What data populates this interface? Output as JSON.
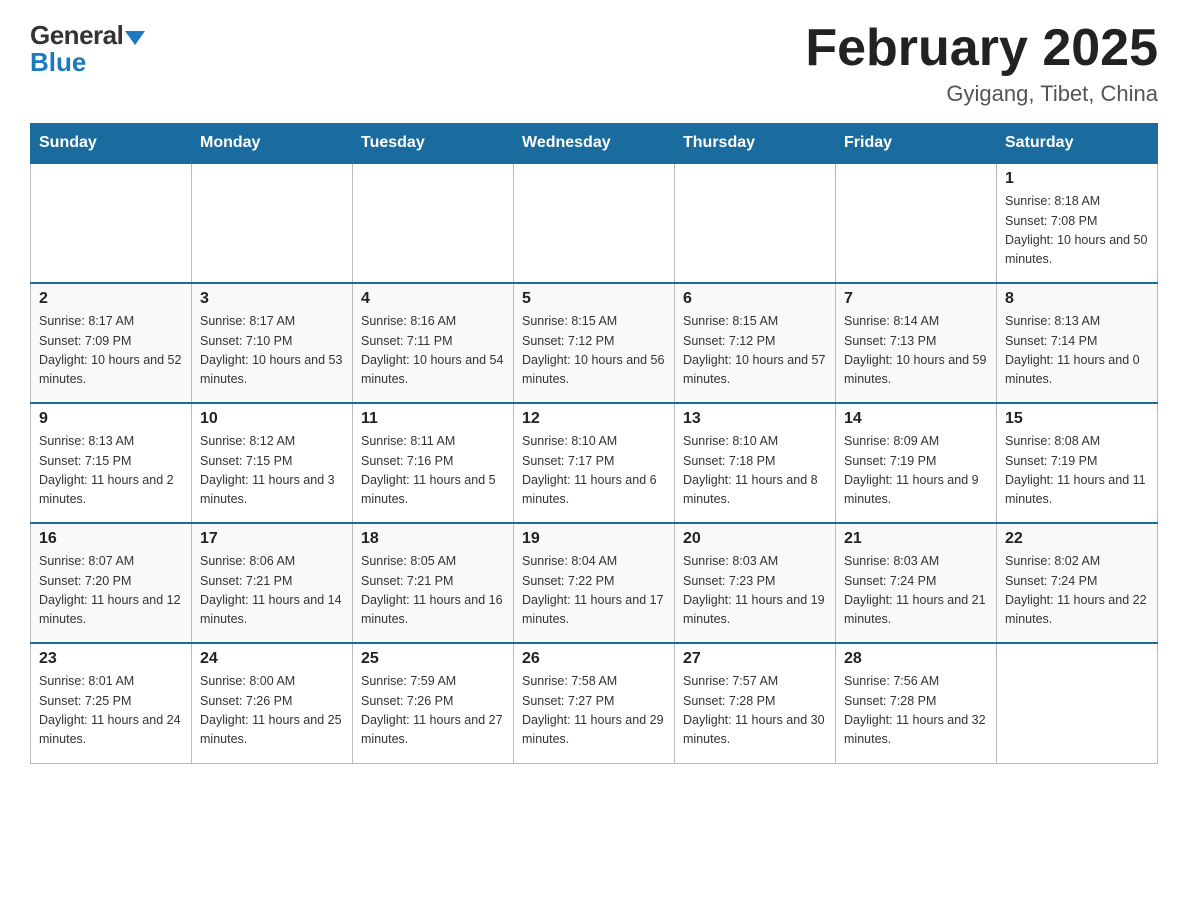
{
  "header": {
    "logo_general": "General",
    "logo_blue": "Blue",
    "title": "February 2025",
    "location": "Gyigang, Tibet, China"
  },
  "days_of_week": [
    "Sunday",
    "Monday",
    "Tuesday",
    "Wednesday",
    "Thursday",
    "Friday",
    "Saturday"
  ],
  "weeks": [
    [
      {
        "day": "",
        "sunrise": "",
        "sunset": "",
        "daylight": ""
      },
      {
        "day": "",
        "sunrise": "",
        "sunset": "",
        "daylight": ""
      },
      {
        "day": "",
        "sunrise": "",
        "sunset": "",
        "daylight": ""
      },
      {
        "day": "",
        "sunrise": "",
        "sunset": "",
        "daylight": ""
      },
      {
        "day": "",
        "sunrise": "",
        "sunset": "",
        "daylight": ""
      },
      {
        "day": "",
        "sunrise": "",
        "sunset": "",
        "daylight": ""
      },
      {
        "day": "1",
        "sunrise": "Sunrise: 8:18 AM",
        "sunset": "Sunset: 7:08 PM",
        "daylight": "Daylight: 10 hours and 50 minutes."
      }
    ],
    [
      {
        "day": "2",
        "sunrise": "Sunrise: 8:17 AM",
        "sunset": "Sunset: 7:09 PM",
        "daylight": "Daylight: 10 hours and 52 minutes."
      },
      {
        "day": "3",
        "sunrise": "Sunrise: 8:17 AM",
        "sunset": "Sunset: 7:10 PM",
        "daylight": "Daylight: 10 hours and 53 minutes."
      },
      {
        "day": "4",
        "sunrise": "Sunrise: 8:16 AM",
        "sunset": "Sunset: 7:11 PM",
        "daylight": "Daylight: 10 hours and 54 minutes."
      },
      {
        "day": "5",
        "sunrise": "Sunrise: 8:15 AM",
        "sunset": "Sunset: 7:12 PM",
        "daylight": "Daylight: 10 hours and 56 minutes."
      },
      {
        "day": "6",
        "sunrise": "Sunrise: 8:15 AM",
        "sunset": "Sunset: 7:12 PM",
        "daylight": "Daylight: 10 hours and 57 minutes."
      },
      {
        "day": "7",
        "sunrise": "Sunrise: 8:14 AM",
        "sunset": "Sunset: 7:13 PM",
        "daylight": "Daylight: 10 hours and 59 minutes."
      },
      {
        "day": "8",
        "sunrise": "Sunrise: 8:13 AM",
        "sunset": "Sunset: 7:14 PM",
        "daylight": "Daylight: 11 hours and 0 minutes."
      }
    ],
    [
      {
        "day": "9",
        "sunrise": "Sunrise: 8:13 AM",
        "sunset": "Sunset: 7:15 PM",
        "daylight": "Daylight: 11 hours and 2 minutes."
      },
      {
        "day": "10",
        "sunrise": "Sunrise: 8:12 AM",
        "sunset": "Sunset: 7:15 PM",
        "daylight": "Daylight: 11 hours and 3 minutes."
      },
      {
        "day": "11",
        "sunrise": "Sunrise: 8:11 AM",
        "sunset": "Sunset: 7:16 PM",
        "daylight": "Daylight: 11 hours and 5 minutes."
      },
      {
        "day": "12",
        "sunrise": "Sunrise: 8:10 AM",
        "sunset": "Sunset: 7:17 PM",
        "daylight": "Daylight: 11 hours and 6 minutes."
      },
      {
        "day": "13",
        "sunrise": "Sunrise: 8:10 AM",
        "sunset": "Sunset: 7:18 PM",
        "daylight": "Daylight: 11 hours and 8 minutes."
      },
      {
        "day": "14",
        "sunrise": "Sunrise: 8:09 AM",
        "sunset": "Sunset: 7:19 PM",
        "daylight": "Daylight: 11 hours and 9 minutes."
      },
      {
        "day": "15",
        "sunrise": "Sunrise: 8:08 AM",
        "sunset": "Sunset: 7:19 PM",
        "daylight": "Daylight: 11 hours and 11 minutes."
      }
    ],
    [
      {
        "day": "16",
        "sunrise": "Sunrise: 8:07 AM",
        "sunset": "Sunset: 7:20 PM",
        "daylight": "Daylight: 11 hours and 12 minutes."
      },
      {
        "day": "17",
        "sunrise": "Sunrise: 8:06 AM",
        "sunset": "Sunset: 7:21 PM",
        "daylight": "Daylight: 11 hours and 14 minutes."
      },
      {
        "day": "18",
        "sunrise": "Sunrise: 8:05 AM",
        "sunset": "Sunset: 7:21 PM",
        "daylight": "Daylight: 11 hours and 16 minutes."
      },
      {
        "day": "19",
        "sunrise": "Sunrise: 8:04 AM",
        "sunset": "Sunset: 7:22 PM",
        "daylight": "Daylight: 11 hours and 17 minutes."
      },
      {
        "day": "20",
        "sunrise": "Sunrise: 8:03 AM",
        "sunset": "Sunset: 7:23 PM",
        "daylight": "Daylight: 11 hours and 19 minutes."
      },
      {
        "day": "21",
        "sunrise": "Sunrise: 8:03 AM",
        "sunset": "Sunset: 7:24 PM",
        "daylight": "Daylight: 11 hours and 21 minutes."
      },
      {
        "day": "22",
        "sunrise": "Sunrise: 8:02 AM",
        "sunset": "Sunset: 7:24 PM",
        "daylight": "Daylight: 11 hours and 22 minutes."
      }
    ],
    [
      {
        "day": "23",
        "sunrise": "Sunrise: 8:01 AM",
        "sunset": "Sunset: 7:25 PM",
        "daylight": "Daylight: 11 hours and 24 minutes."
      },
      {
        "day": "24",
        "sunrise": "Sunrise: 8:00 AM",
        "sunset": "Sunset: 7:26 PM",
        "daylight": "Daylight: 11 hours and 25 minutes."
      },
      {
        "day": "25",
        "sunrise": "Sunrise: 7:59 AM",
        "sunset": "Sunset: 7:26 PM",
        "daylight": "Daylight: 11 hours and 27 minutes."
      },
      {
        "day": "26",
        "sunrise": "Sunrise: 7:58 AM",
        "sunset": "Sunset: 7:27 PM",
        "daylight": "Daylight: 11 hours and 29 minutes."
      },
      {
        "day": "27",
        "sunrise": "Sunrise: 7:57 AM",
        "sunset": "Sunset: 7:28 PM",
        "daylight": "Daylight: 11 hours and 30 minutes."
      },
      {
        "day": "28",
        "sunrise": "Sunrise: 7:56 AM",
        "sunset": "Sunset: 7:28 PM",
        "daylight": "Daylight: 11 hours and 32 minutes."
      },
      {
        "day": "",
        "sunrise": "",
        "sunset": "",
        "daylight": ""
      }
    ]
  ]
}
